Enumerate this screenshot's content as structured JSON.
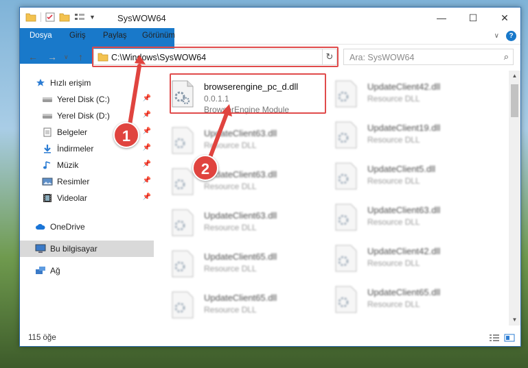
{
  "window": {
    "title": "SysWOW64",
    "minimize": "—",
    "maximize": "☐",
    "close": "✕"
  },
  "ribbon": {
    "tabs": [
      "Dosya",
      "Giriş",
      "Paylaş",
      "Görünüm"
    ],
    "help": "?"
  },
  "address": {
    "path": "C:\\Windows\\SysWOW64",
    "search_placeholder": "Ara: SysWOW64"
  },
  "nav": {
    "items": [
      {
        "label": "Hızlı erişim",
        "icon": "star-icon",
        "pinned": false
      },
      {
        "label": "Yerel Disk (C:)",
        "icon": "drive-icon",
        "pinned": true
      },
      {
        "label": "Yerel Disk (D:)",
        "icon": "drive-icon",
        "pinned": true
      },
      {
        "label": "Belgeler",
        "icon": "document-icon",
        "pinned": true
      },
      {
        "label": "İndirmeler",
        "icon": "download-icon",
        "pinned": true
      },
      {
        "label": "Müzik",
        "icon": "music-icon",
        "pinned": true
      },
      {
        "label": "Resimler",
        "icon": "pictures-icon",
        "pinned": true
      },
      {
        "label": "Videolar",
        "icon": "video-icon",
        "pinned": true
      },
      {
        "label": "OneDrive",
        "icon": "cloud-icon",
        "pinned": false
      },
      {
        "label": "Bu bilgisayar",
        "icon": "computer-icon",
        "pinned": false
      },
      {
        "label": "Ağ",
        "icon": "network-icon",
        "pinned": false
      }
    ]
  },
  "files": {
    "highlighted": {
      "name": "browserengine_pc_d.dll",
      "version": "0.0.1.1",
      "description": "BrowserEngine Module"
    },
    "left": [
      {
        "name": "UpdateClient63.dll",
        "type": "Resource DLL"
      },
      {
        "name": "UpdateClient63.dll",
        "type": "Resource DLL"
      },
      {
        "name": "UpdateClient63.dll",
        "type": "Resource DLL"
      },
      {
        "name": "UpdateClient65.dll",
        "type": "Resource DLL"
      },
      {
        "name": "UpdateClient65.dll",
        "type": "Resource DLL"
      }
    ],
    "right": [
      {
        "name": "UpdateClient42.dll",
        "type": "Resource DLL"
      },
      {
        "name": "UpdateClient19.dll",
        "type": "Resource DLL"
      },
      {
        "name": "UpdateClient5.dll",
        "type": "Resource DLL"
      },
      {
        "name": "UpdateClient63.dll",
        "type": "Resource DLL"
      },
      {
        "name": "UpdateClient42.dll",
        "type": "Resource DLL"
      },
      {
        "name": "UpdateClient65.dll",
        "type": "Resource DLL"
      }
    ]
  },
  "status": {
    "count": "115 öğe"
  },
  "callouts": [
    "1",
    "2"
  ],
  "colors": {
    "accent": "#1979ca",
    "highlight": "#e04a4a"
  }
}
